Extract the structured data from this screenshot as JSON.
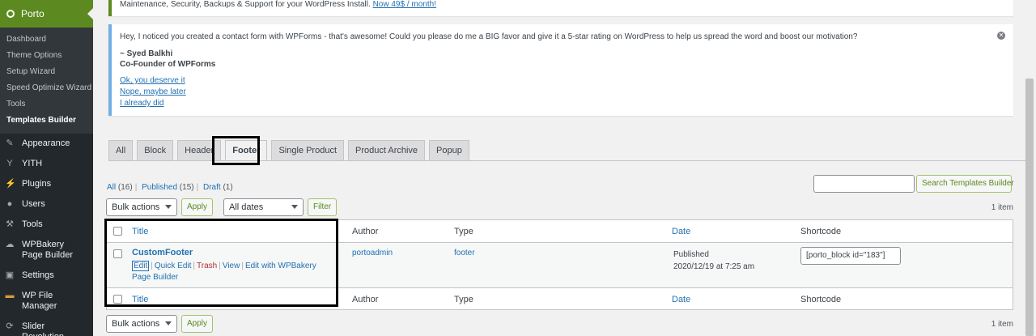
{
  "sidebar": {
    "header": {
      "label": "Porto",
      "icon": "porto-icon"
    },
    "submenu": [
      {
        "label": "Dashboard"
      },
      {
        "label": "Theme Options"
      },
      {
        "label": "Setup Wizard"
      },
      {
        "label": "Speed Optimize Wizard"
      },
      {
        "label": "Tools"
      },
      {
        "label": "Templates Builder"
      }
    ],
    "items": [
      {
        "label": "Appearance",
        "icon": "paintbrush-icon"
      },
      {
        "label": "YITH",
        "icon": "yith-icon"
      },
      {
        "label": "Plugins",
        "icon": "plug-icon"
      },
      {
        "label": "Users",
        "icon": "user-icon"
      },
      {
        "label": "Tools",
        "icon": "wrench-icon"
      },
      {
        "label": "WPBakery Page Builder",
        "icon": "wpbakery-icon"
      },
      {
        "label": "Settings",
        "icon": "settings-icon"
      },
      {
        "label": "WP File Manager",
        "icon": "folder-icon"
      },
      {
        "label": "Slider Revolution",
        "icon": "refresh-icon"
      }
    ],
    "colors": {
      "bg": "#23282d",
      "active": "#5c8a20"
    }
  },
  "notice_top": {
    "text": "Maintenance, Security, Backups & Support for your WordPress Install.",
    "link": "Now 49$ / month!"
  },
  "notice_wpforms": {
    "message": "Hey, I noticed you created a contact form with WPForms - that's awesome! Could you please do me a BIG favor and give it a 5-star rating on WordPress to help us spread the word and boost our motivation?",
    "signature_name": "~ Syed Balkhi",
    "signature_role": "Co-Founder of WPForms",
    "links": [
      "Ok, you deserve it",
      "Nope, maybe later",
      "I already did"
    ],
    "close_icon": "close-icon"
  },
  "tabs": [
    "All",
    "Block",
    "Header",
    "Footer",
    "Single Product",
    "Product Archive",
    "Popup"
  ],
  "active_tab": "Footer",
  "views": {
    "all": "All",
    "all_count": "(16)",
    "published": "Published",
    "published_count": "(15)",
    "draft": "Draft",
    "draft_count": "(1)"
  },
  "search": {
    "button": "Search Templates Builder",
    "value": ""
  },
  "controls": {
    "bulk_actions": "Bulk actions",
    "apply": "Apply",
    "all_dates": "All dates",
    "filter": "Filter",
    "item_count": "1 item"
  },
  "table": {
    "columns": [
      "Title",
      "Author",
      "Type",
      "Date",
      "Shortcode"
    ],
    "rows": [
      {
        "title": "CustomFooter",
        "actions": [
          "Edit",
          "Quick Edit",
          "Trash",
          "View",
          "Edit with WPBakery Page Builder"
        ],
        "author": "portoadmin",
        "type": "footer",
        "date_status": "Published",
        "date": "2020/12/19 at 7:25 am",
        "shortcode": "[porto_block id=\"183\"]"
      }
    ]
  }
}
